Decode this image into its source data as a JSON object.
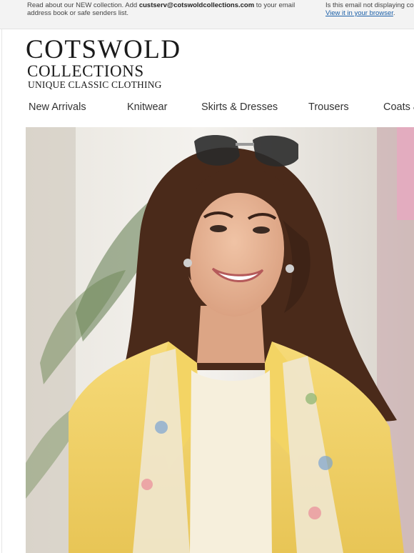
{
  "preheader": {
    "left_text_1": "Read about our NEW collection. Add ",
    "email": "custserv@cotswoldcollections.com",
    "left_text_2": " to your email address book or safe senders list.",
    "right_text": "Is this email not displaying corre",
    "view_link": "View it in your browser",
    "view_link_suffix": "."
  },
  "logo": {
    "main": "COTSWOLD",
    "sub": "COLLECTIONS",
    "tagline": "UNIQUE CLASSIC CLOTHING"
  },
  "nav": {
    "items": [
      {
        "label": "New Arrivals"
      },
      {
        "label": "Knitwear"
      },
      {
        "label": "Skirts & Dresses"
      },
      {
        "label": "Trousers"
      },
      {
        "label": "Coats &"
      }
    ]
  },
  "hero": {
    "colors": {
      "jacket": "#f2d36a",
      "top": "#f6efdc",
      "hair": "#4a2a1a",
      "skin": "#e7b394",
      "background": "#eeeae3"
    }
  }
}
